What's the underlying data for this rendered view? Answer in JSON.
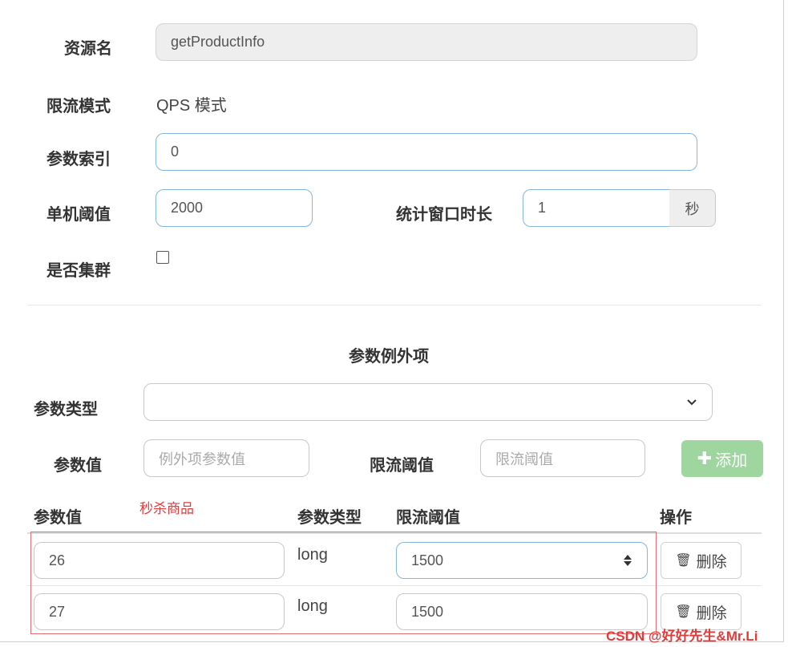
{
  "form": {
    "resource_label": "资源名",
    "resource_value": "getProductInfo",
    "mode_label": "限流模式",
    "mode_value": "QPS 模式",
    "param_index_label": "参数索引",
    "param_index_value": "0",
    "threshold_label": "单机阈值",
    "threshold_value": "2000",
    "window_label": "统计窗口时长",
    "window_value": "1",
    "window_unit": "秒",
    "cluster_label": "是否集群",
    "cluster_checked": false
  },
  "exceptions": {
    "section_title": "参数例外项",
    "type_label": "参数类型",
    "type_value": "",
    "value_label": "参数值",
    "value_placeholder": "例外项参数值",
    "limit_label": "限流阈值",
    "limit_placeholder": "限流阈值",
    "add_button": "添加",
    "annotation": "秒杀商品",
    "table": {
      "headers": [
        "参数值",
        "参数类型",
        "限流阈值",
        "操作"
      ],
      "rows": [
        {
          "value": "26",
          "type": "long",
          "limit": "1500",
          "action": "删除"
        },
        {
          "value": "27",
          "type": "long",
          "limit": "1500",
          "action": "删除"
        }
      ]
    }
  },
  "watermark": "CSDN @好好先生&Mr.Li"
}
